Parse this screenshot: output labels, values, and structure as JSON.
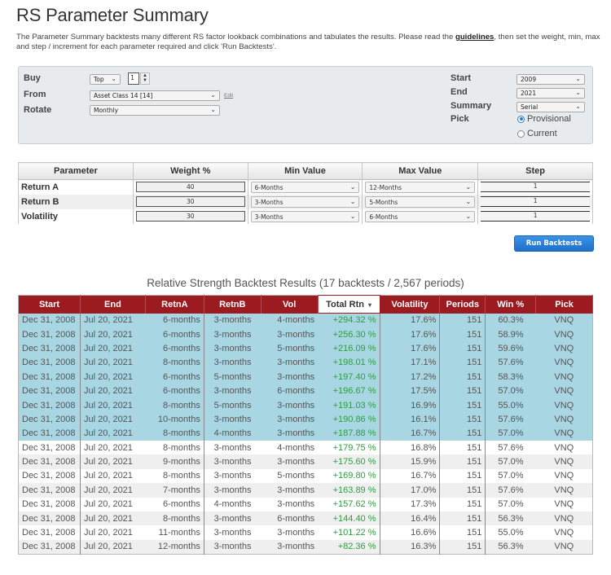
{
  "page": {
    "title": "RS Parameter Summary",
    "intro_before_link": "The Parameter Summary backtests many different RS factor lookback combinations and tabulates the results.  Please read the ",
    "intro_link": "guidelines",
    "intro_after_link": ", then set the weight, min, max and step / increment for each parameter required and click 'Run Backtests'."
  },
  "settings": {
    "buy_label": "Buy",
    "buy_mode": "Top",
    "buy_count": "1",
    "from_label": "From",
    "from_value": "Asset Class 14 [14]",
    "edit_label": "Edit",
    "rotate_label": "Rotate",
    "rotate_value": "Monthly",
    "start_label": "Start",
    "start_value": "2009",
    "end_label": "End",
    "end_value": "2021",
    "summary_label": "Summary",
    "summary_value": "Serial",
    "pick_label": "Pick",
    "pick_options": [
      {
        "label": "Provisional",
        "selected": true
      },
      {
        "label": "Current",
        "selected": false
      }
    ]
  },
  "parameters": {
    "headers": [
      "Parameter",
      "Weight %",
      "Min Value",
      "Max Value",
      "Step"
    ],
    "rows": [
      {
        "name": "Return A",
        "weight": "40",
        "min": "6-Months",
        "max": "12-Months",
        "step": "1"
      },
      {
        "name": "Return B",
        "weight": "30",
        "min": "3-Months",
        "max": "5-Months",
        "step": "1"
      },
      {
        "name": "Volatility",
        "weight": "30",
        "min": "3-Months",
        "max": "6-Months",
        "step": "1"
      }
    ]
  },
  "run_button": "Run Backtests",
  "results": {
    "title": "Relative Strength Backtest Results (17 backtests / 2,567 periods)",
    "headers": [
      "Start",
      "End",
      "RetnA",
      "RetnB",
      "Vol",
      "Total Rtn",
      "Volatility",
      "Periods",
      "Win %",
      "Pick"
    ],
    "sorted_column": "Total Rtn",
    "sort_icon": "▾",
    "highlighted_count": 9,
    "rows": [
      [
        "Dec 31, 2008",
        "Jul 20, 2021",
        "6-months",
        "3-months",
        "4-months",
        "+294.32 %",
        "17.6%",
        "151",
        "60.3%",
        "VNQ"
      ],
      [
        "Dec 31, 2008",
        "Jul 20, 2021",
        "6-months",
        "3-months",
        "3-months",
        "+256.30 %",
        "17.6%",
        "151",
        "58.9%",
        "VNQ"
      ],
      [
        "Dec 31, 2008",
        "Jul 20, 2021",
        "6-months",
        "3-months",
        "5-months",
        "+216.09 %",
        "17.6%",
        "151",
        "59.6%",
        "VNQ"
      ],
      [
        "Dec 31, 2008",
        "Jul 20, 2021",
        "8-months",
        "3-months",
        "3-months",
        "+198.01 %",
        "17.1%",
        "151",
        "57.6%",
        "VNQ"
      ],
      [
        "Dec 31, 2008",
        "Jul 20, 2021",
        "6-months",
        "5-months",
        "3-months",
        "+197.40 %",
        "17.2%",
        "151",
        "58.3%",
        "VNQ"
      ],
      [
        "Dec 31, 2008",
        "Jul 20, 2021",
        "6-months",
        "3-months",
        "6-months",
        "+196.67 %",
        "17.5%",
        "151",
        "57.0%",
        "VNQ"
      ],
      [
        "Dec 31, 2008",
        "Jul 20, 2021",
        "8-months",
        "5-months",
        "3-months",
        "+191.03 %",
        "16.9%",
        "151",
        "55.0%",
        "VNQ"
      ],
      [
        "Dec 31, 2008",
        "Jul 20, 2021",
        "10-months",
        "3-months",
        "3-months",
        "+190.86 %",
        "16.1%",
        "151",
        "57.6%",
        "VNQ"
      ],
      [
        "Dec 31, 2008",
        "Jul 20, 2021",
        "8-months",
        "4-months",
        "3-months",
        "+187.88 %",
        "16.7%",
        "151",
        "57.0%",
        "VNQ"
      ],
      [
        "Dec 31, 2008",
        "Jul 20, 2021",
        "8-months",
        "3-months",
        "4-months",
        "+179.75 %",
        "16.8%",
        "151",
        "57.6%",
        "VNQ"
      ],
      [
        "Dec 31, 2008",
        "Jul 20, 2021",
        "9-months",
        "3-months",
        "3-months",
        "+175.60 %",
        "15.9%",
        "151",
        "57.0%",
        "VNQ"
      ],
      [
        "Dec 31, 2008",
        "Jul 20, 2021",
        "8-months",
        "3-months",
        "5-months",
        "+169.80 %",
        "16.7%",
        "151",
        "57.0%",
        "VNQ"
      ],
      [
        "Dec 31, 2008",
        "Jul 20, 2021",
        "7-months",
        "3-months",
        "3-months",
        "+163.89 %",
        "17.0%",
        "151",
        "57.6%",
        "VNQ"
      ],
      [
        "Dec 31, 2008",
        "Jul 20, 2021",
        "6-months",
        "4-months",
        "3-months",
        "+157.62 %",
        "17.3%",
        "151",
        "57.0%",
        "VNQ"
      ],
      [
        "Dec 31, 2008",
        "Jul 20, 2021",
        "8-months",
        "3-months",
        "6-months",
        "+144.40 %",
        "16.4%",
        "151",
        "56.3%",
        "VNQ"
      ],
      [
        "Dec 31, 2008",
        "Jul 20, 2021",
        "11-months",
        "3-months",
        "3-months",
        "+101.22 %",
        "16.6%",
        "151",
        "55.0%",
        "VNQ"
      ],
      [
        "Dec 31, 2008",
        "Jul 20, 2021",
        "12-months",
        "3-months",
        "3-months",
        "+82.36 %",
        "16.3%",
        "151",
        "56.3%",
        "VNQ"
      ]
    ]
  },
  "colors": {
    "header_red": "#9b1b20",
    "highlight_blue": "#a9d6e3",
    "positive_green": "#2e9e3e",
    "button_blue": "#2a7bd3"
  }
}
